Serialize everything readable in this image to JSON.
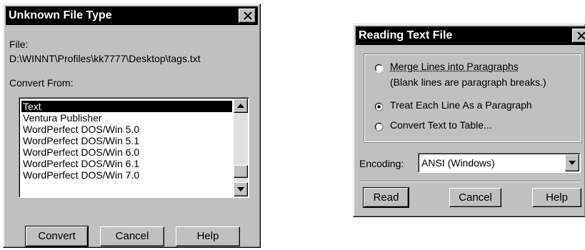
{
  "dialog1": {
    "title": "Unknown File Type",
    "file_label": "File:",
    "file_path": "D:\\WINNT\\Profiles\\kk7777\\Desktop\\tags.txt",
    "convert_from_label": "Convert From:",
    "list_items": [
      "Text",
      "Ventura Publisher",
      "WordPerfect DOS/Win 5.0",
      "WordPerfect DOS/Win 5.1",
      "WordPerfect DOS/Win 6.0",
      "WordPerfect DOS/Win 6.1",
      "WordPerfect DOS/Win 7.0"
    ],
    "selected_item": "Text",
    "buttons": {
      "convert": "Convert",
      "cancel": "Cancel",
      "help": "Help"
    }
  },
  "dialog2": {
    "title": "Reading Text File",
    "options": [
      {
        "label": "Merge Lines into Paragraphs",
        "note": "(Blank lines are paragraph breaks.)",
        "checked": false
      },
      {
        "label": "Treat Each Line As a Paragraph",
        "checked": true
      },
      {
        "label": "Convert Text to Table...",
        "checked": false
      }
    ],
    "encoding_label": "Encoding:",
    "encoding_value": "ANSI (Windows)",
    "buttons": {
      "read": "Read",
      "cancel": "Cancel",
      "help": "Help"
    }
  }
}
